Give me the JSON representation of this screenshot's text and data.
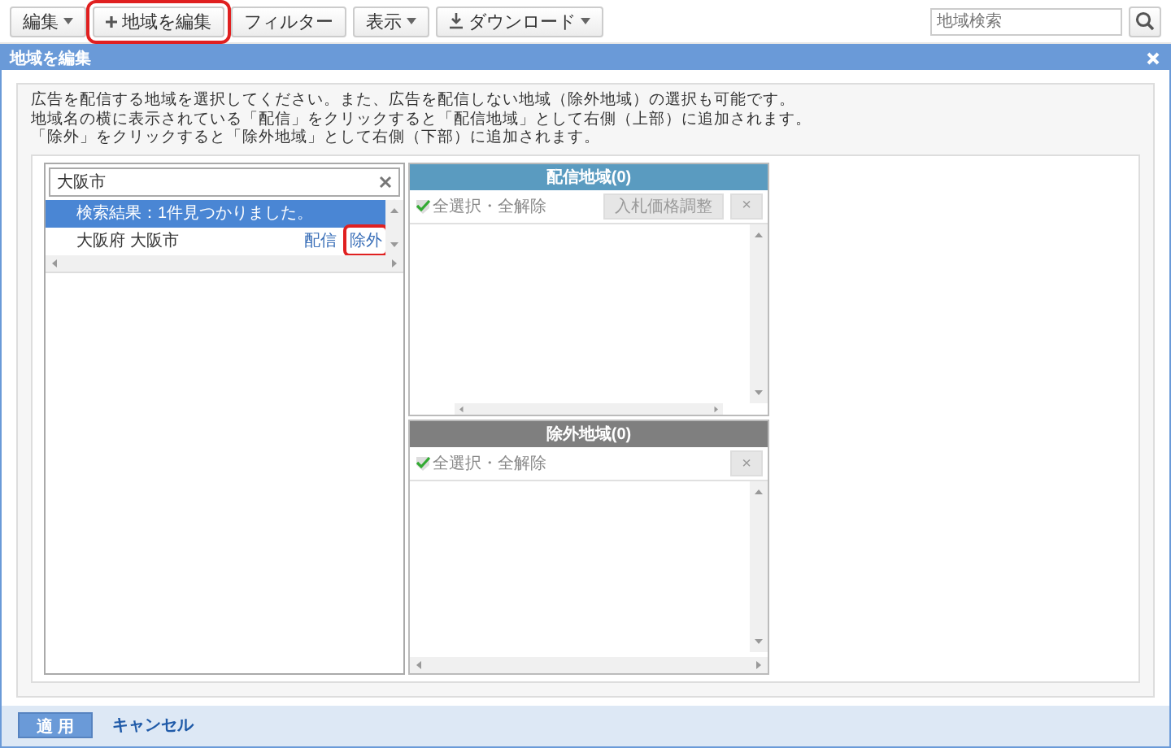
{
  "toolbar": {
    "buttons": [
      {
        "label": "編集",
        "kind": "dropdown",
        "highlighted": false
      },
      {
        "label": "地域を編集",
        "kind": "add",
        "highlighted": true
      },
      {
        "label": "フィルター",
        "kind": "plain",
        "highlighted": false
      },
      {
        "label": "表示",
        "kind": "dropdown",
        "highlighted": false
      },
      {
        "label": "ダウンロード",
        "kind": "download",
        "highlighted": false
      }
    ],
    "search": {
      "placeholder": "地域検索"
    }
  },
  "dialog": {
    "title": "地域を編集",
    "instructions": [
      "広告を配信する地域を選択してください。また、広告を配信しない地域（除外地域）の選択も可能です。",
      "地域名の横に表示されている「配信」をクリックすると「配信地域」として右側（上部）に追加されます。",
      "「除外」をクリックすると「除外地域」として右側（下部）に追加されます。"
    ],
    "search_box": {
      "value": "大阪市"
    },
    "results": {
      "message": "検索結果：1件見つかりました。",
      "rows": [
        {
          "name": "大阪府 大阪市",
          "actions": [
            {
              "label": "配信",
              "highlighted": false
            },
            {
              "label": "除外",
              "highlighted": true
            }
          ]
        }
      ]
    },
    "panels": [
      {
        "kind": "delivery",
        "title": "配信地域(0)",
        "select_all": "全選択・全解除",
        "buttons": [
          {
            "label": "入札価格調整",
            "disabled": true
          }
        ],
        "clear": "×"
      },
      {
        "kind": "excluded",
        "title": "除外地域(0)",
        "select_all": "全選択・全解除",
        "clear": "×"
      }
    ]
  },
  "footer": {
    "apply": "適 用",
    "cancel": "キャンセル"
  }
}
